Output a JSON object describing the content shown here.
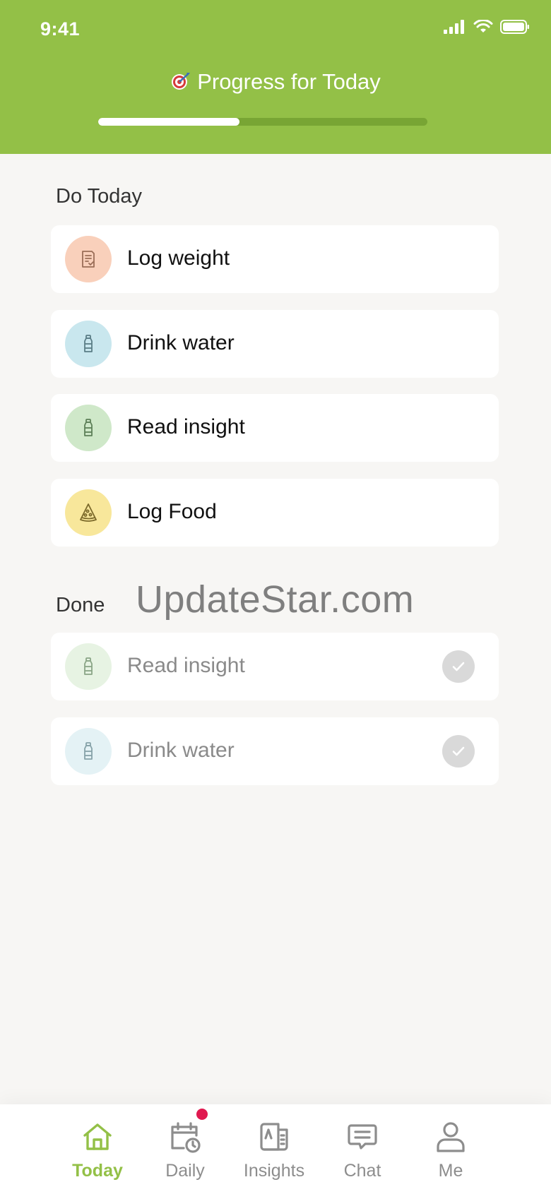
{
  "status_bar": {
    "time": "9:41"
  },
  "header": {
    "title": "Progress for Today",
    "progress_fraction": 0.43,
    "accent_color": "#93c047"
  },
  "sections": {
    "todo": {
      "title": "Do Today",
      "items": [
        {
          "label": "Log weight",
          "icon": "clipboard-check-icon",
          "circle_color": "#f9d0bb"
        },
        {
          "label": "Drink water",
          "icon": "bottle-icon",
          "circle_color": "#c9e7ee"
        },
        {
          "label": "Read insight",
          "icon": "bottle-icon",
          "circle_color": "#cfe8c9"
        },
        {
          "label": "Log Food",
          "icon": "pizza-slice-icon",
          "circle_color": "#f8e79b"
        }
      ]
    },
    "done": {
      "title": "Done",
      "items": [
        {
          "label": "Read insight",
          "icon": "bottle-icon",
          "circle_color": "#e7f3e3",
          "completed": true
        },
        {
          "label": "Drink water",
          "icon": "bottle-icon",
          "circle_color": "#e4f2f5",
          "completed": true
        }
      ]
    }
  },
  "watermark": "UpdateStar.com",
  "tabbar": {
    "tabs": [
      {
        "label": "Today",
        "icon": "home-icon",
        "active": true
      },
      {
        "label": "Daily",
        "icon": "calendar-clock-icon",
        "badge": true
      },
      {
        "label": "Insights",
        "icon": "newspaper-icon"
      },
      {
        "label": "Chat",
        "icon": "chat-bubble-icon"
      },
      {
        "label": "Me",
        "icon": "person-icon"
      }
    ]
  }
}
